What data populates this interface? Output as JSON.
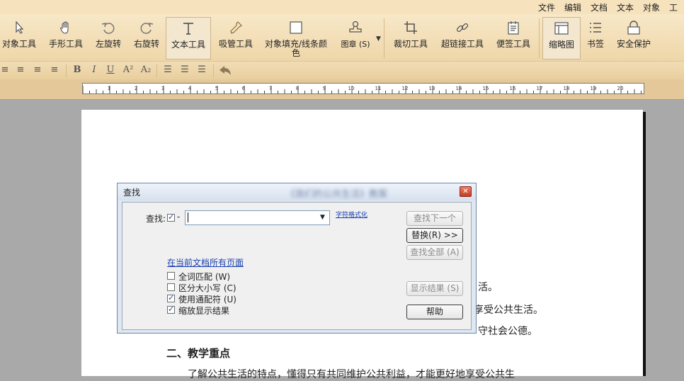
{
  "menu": [
    "文件",
    "编辑",
    "文档",
    "文本",
    "对象",
    "工具"
  ],
  "tools": [
    {
      "name": "object-tool",
      "label": "对象工具",
      "icon": "pointer-icon"
    },
    {
      "name": "hand-tool",
      "label": "手形工具",
      "icon": "hand-icon"
    },
    {
      "name": "rotate-left",
      "label": "左旋转",
      "icon": "rotate-left-icon"
    },
    {
      "name": "rotate-right",
      "label": "右旋转",
      "icon": "rotate-right-icon"
    },
    {
      "name": "text-tool",
      "label": "文本工具",
      "icon": "text-icon"
    },
    {
      "name": "eyedropper-tool",
      "label": "吸管工具",
      "icon": "eyedropper-icon"
    },
    {
      "name": "fill-tool",
      "label": "对象填充/线条颜色",
      "icon": "fill-icon"
    },
    {
      "name": "stamp-tool",
      "label": "图章 (S)",
      "icon": "stamp-icon"
    },
    {
      "name": "crop-tool",
      "label": "裁切工具",
      "icon": "crop-icon"
    },
    {
      "name": "hyperlink-tool",
      "label": "超链接工具",
      "icon": "link-icon"
    },
    {
      "name": "note-tool",
      "label": "便签工具",
      "icon": "note-icon"
    },
    {
      "name": "thumbnail",
      "label": "缩略图",
      "icon": "thumbnail-icon"
    },
    {
      "name": "bookmark",
      "label": "书签",
      "icon": "bookmark-icon"
    },
    {
      "name": "security",
      "label": "安全保护",
      "icon": "lock-icon"
    }
  ],
  "format": {
    "bold": "B",
    "italic": "I",
    "underline": "U",
    "superscript": "A²",
    "subscript": "A₂"
  },
  "ruler_numbers": [
    "1",
    "2",
    "3",
    "4",
    "5",
    "6",
    "7",
    "8",
    "9",
    "10",
    "11",
    "12",
    "13",
    "14",
    "15",
    "16",
    "17",
    "18",
    "19",
    "20"
  ],
  "document": {
    "line1": "活。",
    "line2": "地享受公共生活。",
    "line3": "守社会公德。",
    "heading": "二、教学重点",
    "line4": "了解公共生活的特点，懂得只有共同维护公共利益，才能更好地享受公共生"
  },
  "dialog": {
    "title": "查找",
    "blurred_title": "《我们的公共生活》教案",
    "find_label": "查找:",
    "find_value": "",
    "link_format": "字符格式化",
    "scope_link": "在当前文档所有页面",
    "buttons": {
      "find_next": "查找下一个",
      "replace": "替换(R) >>",
      "find_all": "查找全部 (A)",
      "show_results": "显示结果 (S)",
      "help": "帮助"
    },
    "options": [
      {
        "label": "全词匹配 (W)",
        "checked": false
      },
      {
        "label": "区分大小写 (C)",
        "checked": false
      },
      {
        "label": "使用通配符 (U)",
        "checked": true
      },
      {
        "label": "缩放显示结果",
        "checked": true
      }
    ]
  }
}
